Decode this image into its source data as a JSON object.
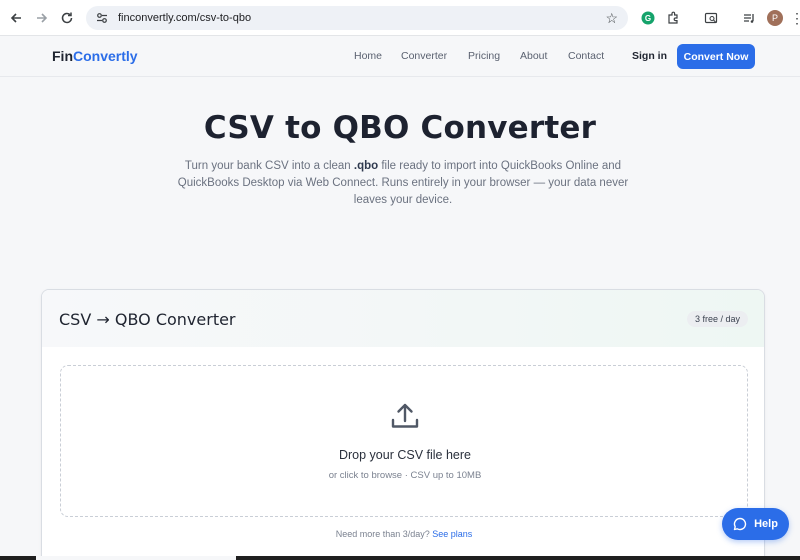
{
  "browser": {
    "url": "finconvertly.com/csv-to-qbo",
    "avatar_initial": "P"
  },
  "site": {
    "logo_part1": "Fin",
    "logo_part2": "Convertly",
    "nav": [
      {
        "label": "Home"
      },
      {
        "label": "Converter"
      },
      {
        "label": "Pricing"
      },
      {
        "label": "About"
      },
      {
        "label": "Contact"
      }
    ],
    "signin_label": "Sign in",
    "cta_label": "Convert Now",
    "accent_color": "#2b6de8"
  },
  "hero": {
    "title": "CSV to QBO Converter",
    "sub_part1": "Turn your bank CSV into a clean ",
    "sub_bold": ".qbo",
    "sub_part2": " file ready to import into QuickBooks Online and QuickBooks Desktop via Web Connect. Runs entirely in your browser — your data never leaves your device."
  },
  "card": {
    "title": "CSV → QBO Converter",
    "badge": "3 free / day",
    "drop_title": "Drop your CSV file here",
    "drop_sub": "or click to browse · CSV up to 10MB",
    "foot_text": "Need more than 3/day? ",
    "foot_link": "See plans"
  },
  "help": {
    "label": "Help"
  }
}
